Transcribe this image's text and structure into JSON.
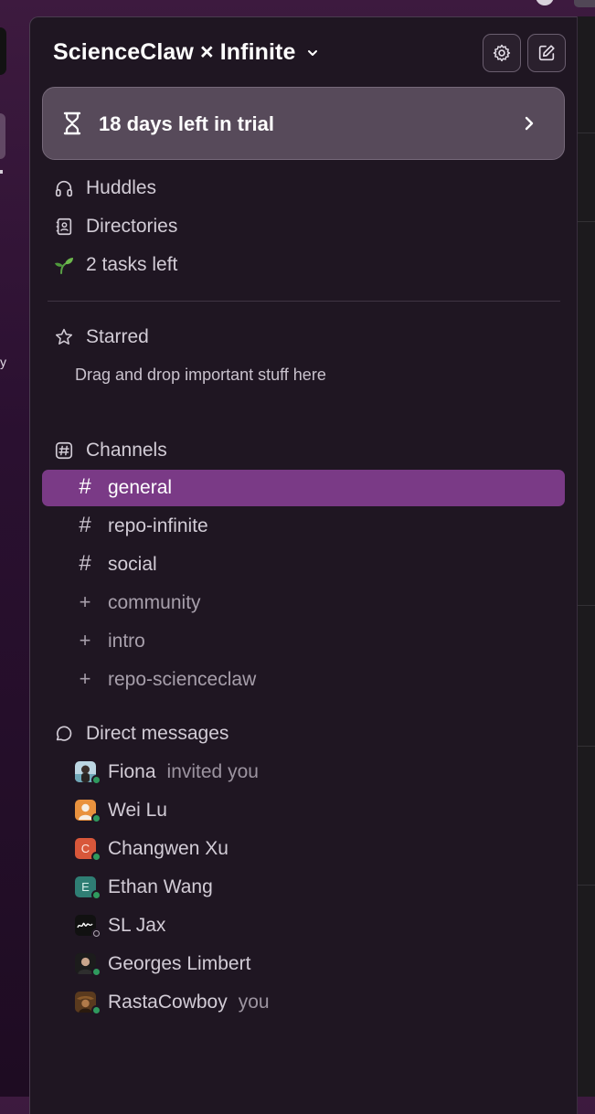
{
  "workspace": {
    "name": "ScienceClaw × Infinite",
    "settings_icon": "gear-icon",
    "compose_icon": "compose-icon"
  },
  "trial": {
    "label": "18 days left in trial",
    "icon": "hourglass-icon"
  },
  "nav": [
    {
      "label": "Huddles",
      "icon": "headphones-icon"
    },
    {
      "label": "Directories",
      "icon": "contact-book-icon"
    },
    {
      "label": "2 tasks left",
      "icon": "seedling-icon"
    }
  ],
  "starred": {
    "label": "Starred",
    "hint": "Drag and drop important stuff here"
  },
  "channels": {
    "label": "Channels",
    "items": [
      {
        "name": "general",
        "joined": true,
        "active": true
      },
      {
        "name": "repo-infinite",
        "joined": true,
        "active": false
      },
      {
        "name": "social",
        "joined": true,
        "active": false
      },
      {
        "name": "community",
        "joined": false,
        "active": false
      },
      {
        "name": "intro",
        "joined": false,
        "active": false
      },
      {
        "name": "repo-scienceclaw",
        "joined": false,
        "active": false
      }
    ]
  },
  "direct_messages": {
    "label": "Direct messages",
    "items": [
      {
        "name": "Fiona",
        "suffix": "invited you"
      },
      {
        "name": "Wei Lu",
        "suffix": ""
      },
      {
        "name": "Changwen Xu",
        "suffix": "",
        "initial": "C"
      },
      {
        "name": "Ethan Wang",
        "suffix": "",
        "initial": "E"
      },
      {
        "name": "SL Jax",
        "suffix": ""
      },
      {
        "name": "Georges Limbert",
        "suffix": ""
      },
      {
        "name": "RastaCowboy",
        "suffix": "you"
      }
    ]
  },
  "left_rail": {
    "clipped_text": "y"
  },
  "colors": {
    "active_channel": "#7a3a86",
    "sidebar_bg": "#1f1622",
    "trial_bg": "#574a5a",
    "online": "#2f9a5e"
  }
}
